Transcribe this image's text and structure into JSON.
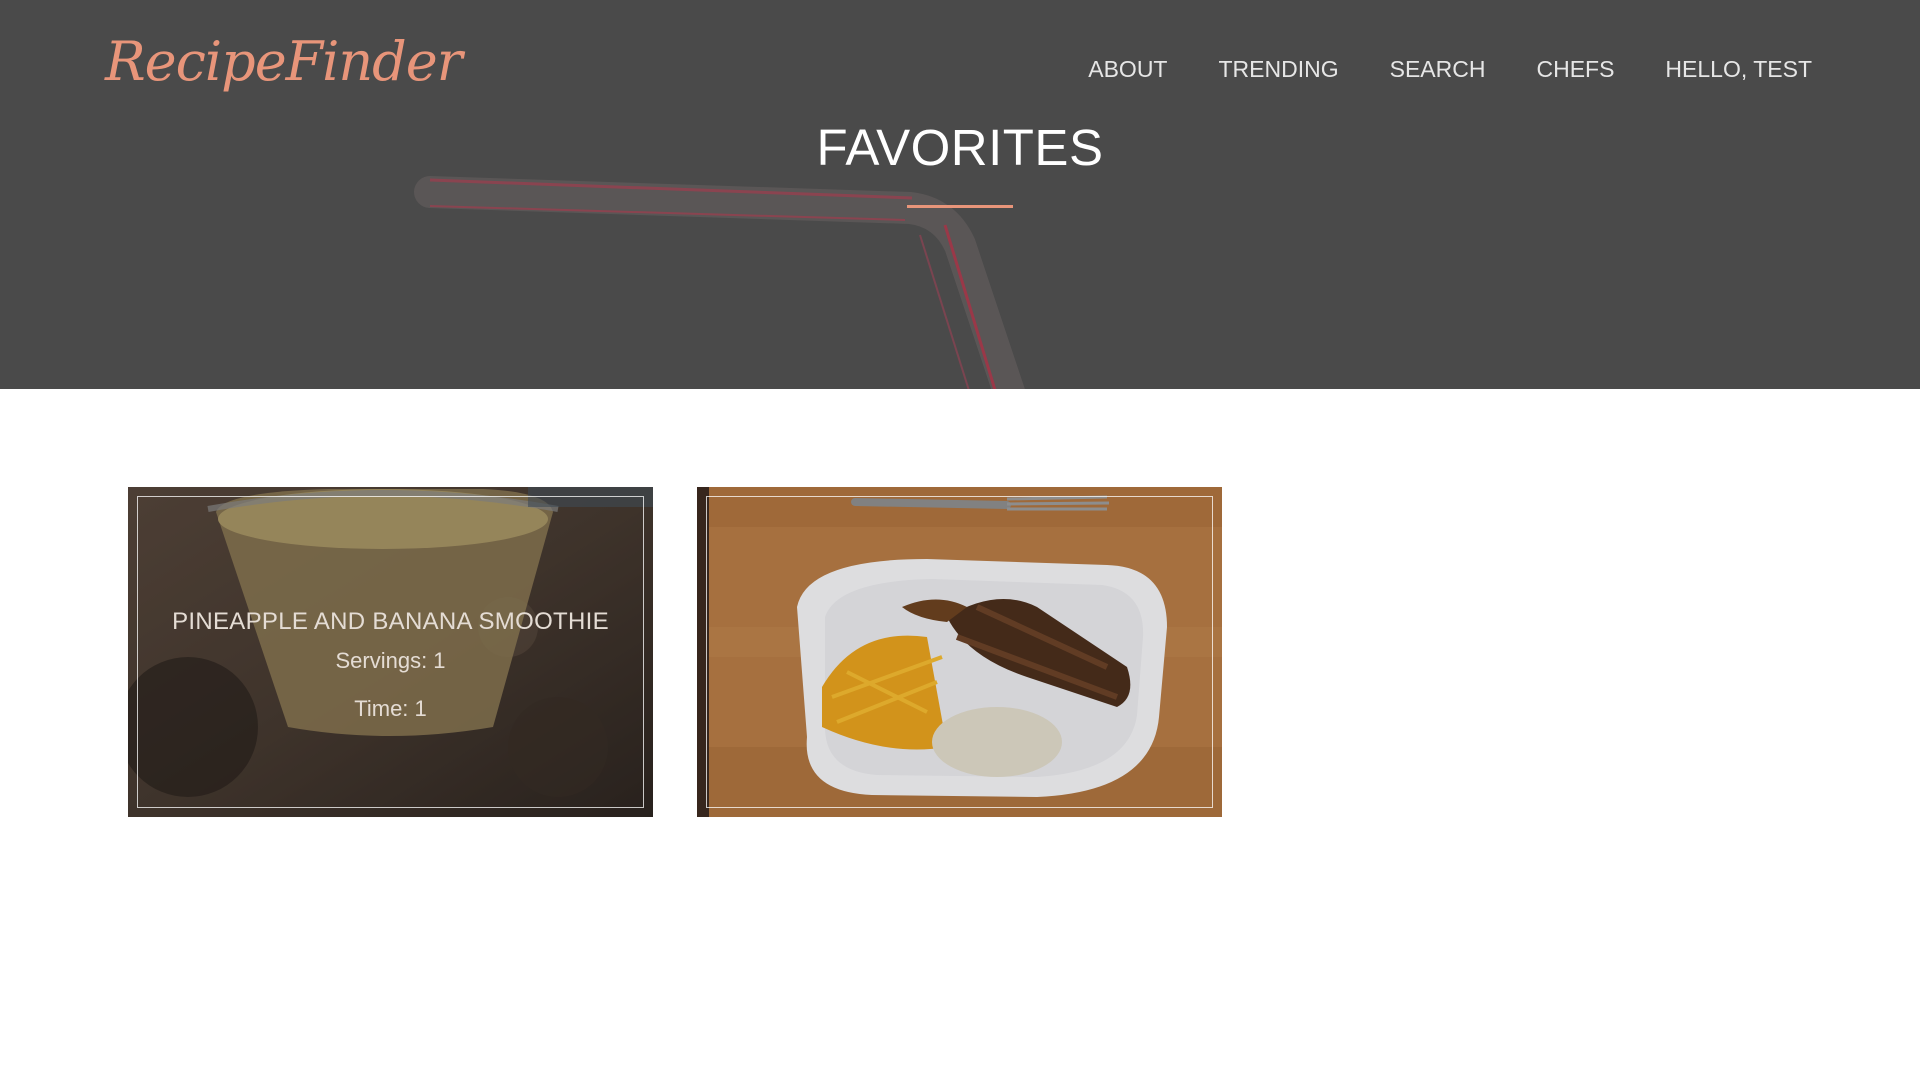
{
  "header": {
    "logo": "RecipeFinder",
    "nav": [
      {
        "label": "ABOUT"
      },
      {
        "label": "TRENDING"
      },
      {
        "label": "SEARCH"
      },
      {
        "label": "CHEFS"
      },
      {
        "label": "HELLO, TEST"
      }
    ]
  },
  "hero": {
    "title": "FAVORITES",
    "accent_color": "#e8957a",
    "overlay_color": "#4a4a4a"
  },
  "favorites": [
    {
      "title": "PINEAPPLE AND BANANA SMOOTHIE",
      "servings": "Servings: 1",
      "time": "Time: 1"
    },
    {
      "title": "",
      "servings": "",
      "time": ""
    }
  ]
}
